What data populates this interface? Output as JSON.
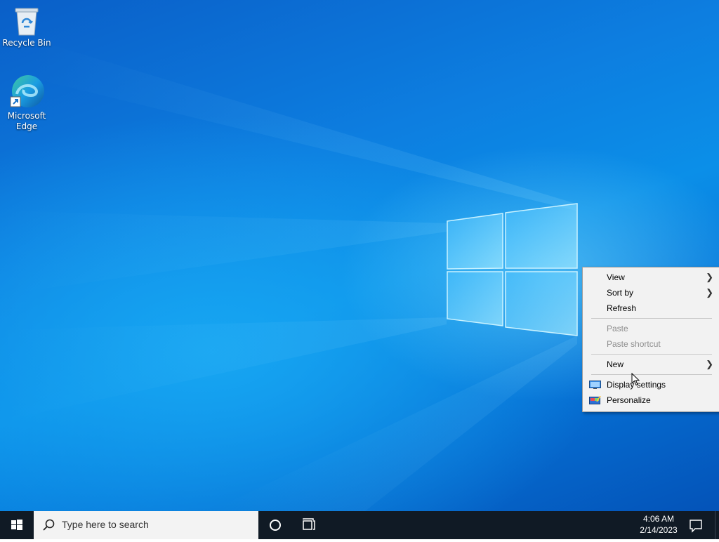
{
  "desktop": {
    "icons": [
      {
        "name": "recycle-bin",
        "label": "Recycle Bin"
      },
      {
        "name": "microsoft-edge",
        "label": "Microsoft Edge"
      }
    ]
  },
  "context_menu": {
    "items": [
      {
        "label": "View",
        "submenu": true,
        "enabled": true
      },
      {
        "label": "Sort by",
        "submenu": true,
        "enabled": true
      },
      {
        "label": "Refresh",
        "submenu": false,
        "enabled": true
      },
      {
        "label": "Paste",
        "submenu": false,
        "enabled": false
      },
      {
        "label": "Paste shortcut",
        "submenu": false,
        "enabled": false
      },
      {
        "label": "New",
        "submenu": true,
        "enabled": true
      },
      {
        "label": "Display settings",
        "submenu": false,
        "enabled": true,
        "icon": "display-icon"
      },
      {
        "label": "Personalize",
        "submenu": false,
        "enabled": true,
        "icon": "personalize-icon"
      }
    ]
  },
  "taskbar": {
    "search_placeholder": "Type here to search",
    "time": "4:06 AM",
    "date": "2/14/2023",
    "icons": [
      "windows-start-icon",
      "search-icon",
      "cortana-icon",
      "task-view-icon",
      "notification-icon"
    ]
  },
  "colors": {
    "taskbar_bg": "#101a25",
    "menu_bg": "#f2f2f2",
    "disabled_text": "#8d8d8d"
  }
}
